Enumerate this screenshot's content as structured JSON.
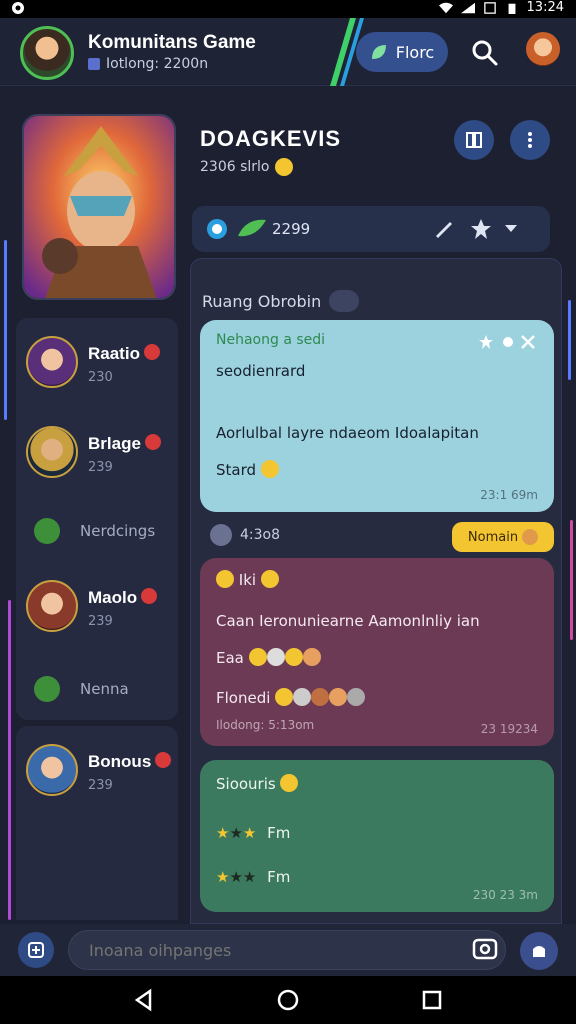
{
  "status_bar": {
    "time": "13:24"
  },
  "header": {
    "title": "Komunitans Game",
    "subtitle": "Iotlong: 2200n",
    "pill_label": "Florc"
  },
  "game": {
    "title": "DOAGKEVIS",
    "subtitle": "2306 slrlo"
  },
  "info_bar": {
    "count": "2299"
  },
  "sidebar": {
    "items": [
      {
        "name": "Raatio",
        "sub": "230"
      },
      {
        "name": "Brlage",
        "sub": "239"
      },
      {
        "link": "Nerdcings"
      },
      {
        "name": "Maolo",
        "sub": "239"
      },
      {
        "link": "Nenna"
      },
      {
        "name": "Bonous",
        "sub": "239"
      }
    ]
  },
  "chat": {
    "room_title": "Ruang Obrobin",
    "messages": [
      {
        "header": "Nehaong a sedi",
        "line1": "seodienrard",
        "line2": "Aorlulbal layre ndaeom Idoalapitan",
        "line3": "Stard",
        "time": "23:1 69m"
      },
      {
        "header": "Iki",
        "line1": "Caan Ieronuniearne Aamonlnliy ian",
        "line2": "Eaa",
        "line3": "Flonedi",
        "sub": "Ilodong: 5:13om",
        "time": "23 19234"
      },
      {
        "header": "Sioouris",
        "line1": "Fm",
        "line2": "Fm",
        "time": "230 23 3m"
      }
    ],
    "meta": "4:3o8",
    "tag_chip": "Nomain"
  },
  "composer": {
    "placeholder": "Inoana oihpanges"
  },
  "colors": {
    "bg": "#1c2030",
    "accent_blue": "#2f4b86",
    "bubble_cyan": "#9cd2dd",
    "bubble_purple": "#6d3a55",
    "bubble_green": "#3b7a5e",
    "chip_yellow": "#f2c531"
  },
  "icons": {
    "header": [
      "avatar",
      "leaf-icon",
      "search-icon",
      "profile-avatar"
    ],
    "game": [
      "library-icon",
      "more-icon"
    ],
    "info_bar": [
      "info-icon",
      "leaf-icon",
      "edit-icon",
      "star-icon",
      "chevron-down-icon"
    ],
    "composer": [
      "add-icon",
      "camera-icon",
      "send-icon"
    ],
    "navbar": [
      "back-icon",
      "home-icon",
      "recents-icon"
    ]
  }
}
